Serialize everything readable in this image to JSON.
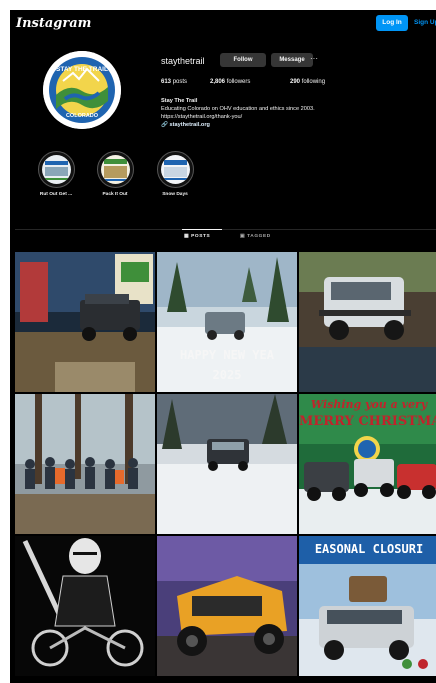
{
  "header": {
    "logo": "Instagram",
    "login_label": "Log In",
    "signup_label": "Sign Up"
  },
  "profile": {
    "username": "staythetrail",
    "follow_label": "Follow",
    "message_label": "Message",
    "more_label": "···",
    "avatar_text_top": "STAY THE TRAIL",
    "avatar_text_bottom": "COLORADO",
    "stats": {
      "posts": "613",
      "posts_label": "posts",
      "followers": "2,806",
      "followers_label": "followers",
      "following": "290",
      "following_label": "following"
    },
    "bio": {
      "name": "Stay The Trail",
      "description": "Educating Colorado on OHV education and ethics since 2003.",
      "url_line": "https://staythetrail.org/thank-you/",
      "link": "staythetrail.org"
    }
  },
  "highlights": [
    {
      "label": "Rut Out Get ..."
    },
    {
      "label": "Pack It Out"
    },
    {
      "label": "Snow Days"
    }
  ],
  "tabs": {
    "posts": "POSTS",
    "tagged": "TAGGED"
  },
  "posts": {
    "p2_caption_line1": "HAPPY NEW YEA",
    "p2_caption_line2": "2025",
    "p6_caption_line1": "Wishing you a very",
    "p6_caption_line2": "MERRY CHRISTMA",
    "p9_caption": "EASONAL CLOSURI"
  },
  "colors": {
    "follow_button": "#363636",
    "login_button": "#0095f6",
    "background": "#000000",
    "christmas_red": "#c0242c",
    "closure_blue": "#1e5fa8"
  }
}
